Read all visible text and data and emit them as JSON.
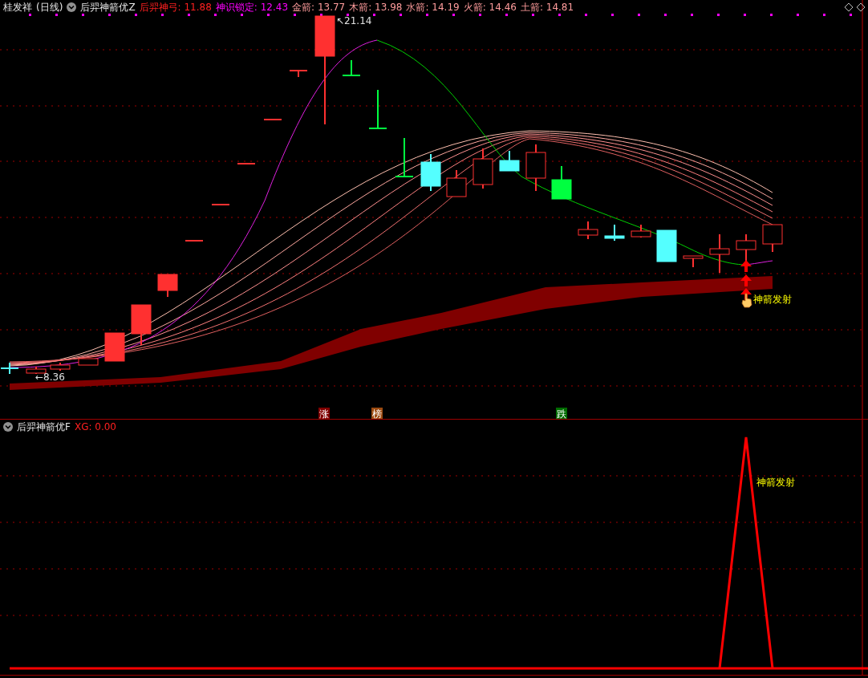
{
  "main_panel": {
    "stock": "桂发祥",
    "period": "(日线)",
    "indicator": "后羿神箭优Z",
    "values": [
      {
        "label": "后羿神弓:",
        "value": "11.88",
        "color": "#ff2020"
      },
      {
        "label": "神识锁定:",
        "value": "12.43",
        "color": "#ff00ff"
      },
      {
        "label": "金箭:",
        "value": "13.77",
        "color": "#ff9c9c"
      },
      {
        "label": "木箭:",
        "value": "13.98",
        "color": "#ff9c9c"
      },
      {
        "label": "水箭:",
        "value": "14.19",
        "color": "#ff9c9c"
      },
      {
        "label": "火箭:",
        "value": "14.46",
        "color": "#ff9c9c"
      },
      {
        "label": "土箭:",
        "value": "14.81",
        "color": "#ff9c9c"
      }
    ],
    "high_label": "↖21.14",
    "low_label": "←8.36",
    "signal_label": "神箭发射",
    "badges": [
      {
        "text": "涨",
        "color": "#800000"
      },
      {
        "text": "榜",
        "color": "#9c4a10"
      },
      {
        "text": "跌",
        "color": "#006b00"
      }
    ]
  },
  "sub_panel": {
    "indicator": "后羿神箭优F",
    "value": "XG: 0.00",
    "signal_label": "神箭发射"
  }
}
